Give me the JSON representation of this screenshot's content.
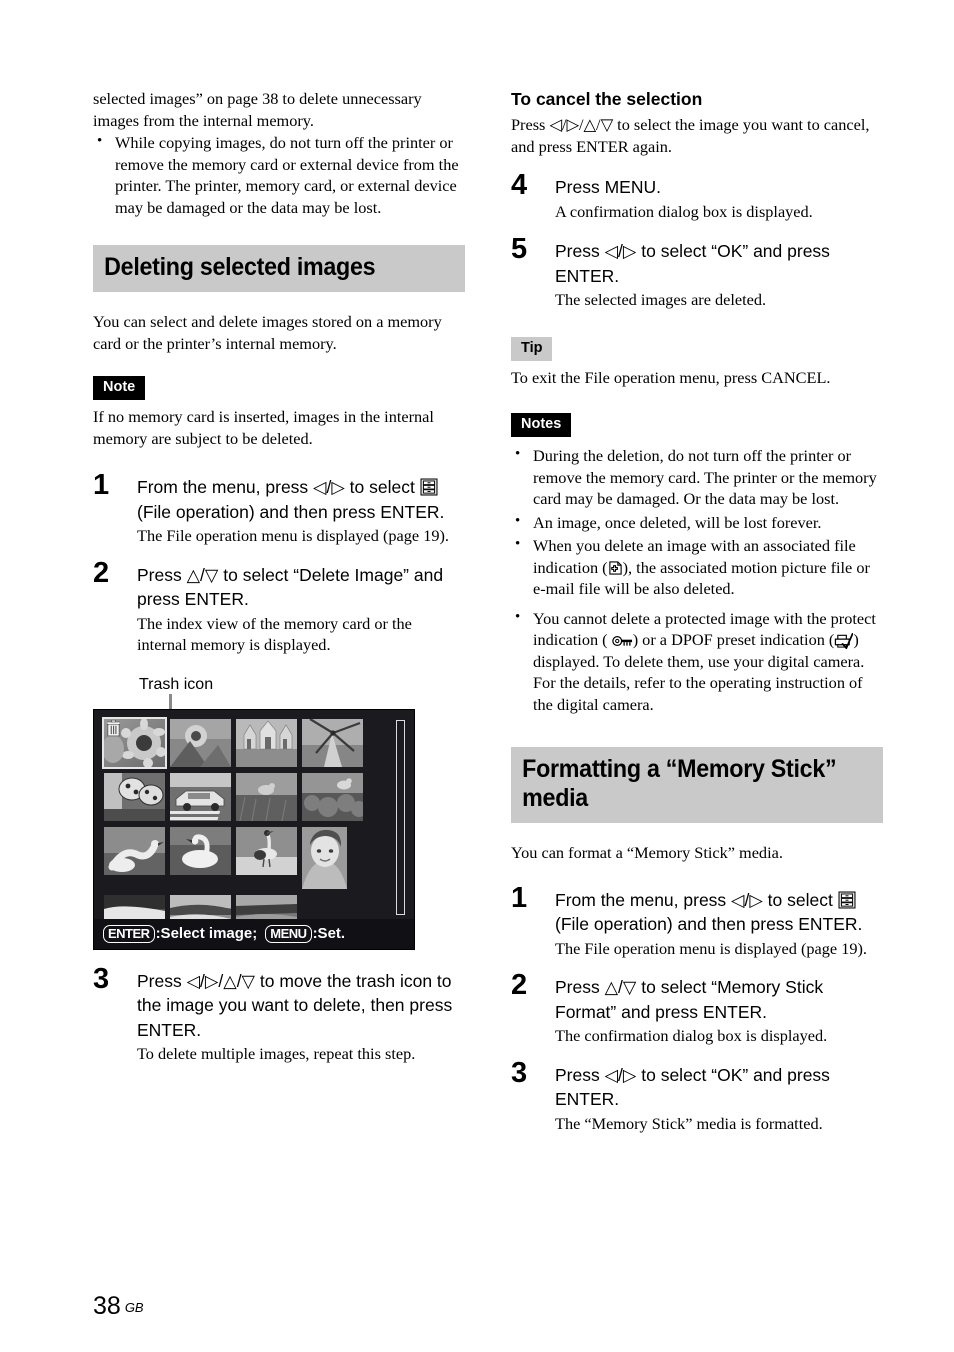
{
  "page": {
    "number": "38",
    "region": "GB"
  },
  "left_column": {
    "continued_paragraph": "selected images” on page 38 to delete unnecessary images from the internal memory.",
    "bullets": [
      "While copying images, do not turn off the printer or remove the memory card or external device from the printer. The printer, memory card, or external device may be damaged or the data may be lost."
    ],
    "section_heading": "Deleting selected images",
    "intro": "You can select and delete images stored on a memory card or the printer’s internal memory.",
    "note_label": "Note",
    "note_text": "If no memory card is inserted, images in the internal memory are subject to be deleted.",
    "steps": [
      {
        "num": "1",
        "main_before": "From the menu, press ◁/▷ to select",
        "main_after": "(File operation) and then press ENTER.",
        "sub": "The File operation menu is displayed (page 19)."
      },
      {
        "num": "2",
        "main": "Press △/▽ to select “Delete Image” and press ENTER.",
        "sub": "The index view of the memory card or the internal memory is displayed."
      },
      {
        "num": "3",
        "main": "Press ◁/▷/△/▽ to move the trash icon to the image you want to delete, then press ENTER.",
        "sub": "To delete multiple images, repeat this step."
      }
    ],
    "illustration": {
      "callout_label": "Trash icon",
      "status_bar": {
        "key1": "ENTER",
        "text1": ":Select image;",
        "key2": "MENU",
        "text2": ":Set."
      },
      "thumbnails": [
        [
          "sunflower",
          "sunflower-bud",
          "cathedral",
          "windmill"
        ],
        [
          "ladybugs",
          "taxi-crosswalk",
          "bird-in-grass",
          "bird-on-shrub"
        ],
        [
          "geese",
          "swan",
          "crane",
          "child-portrait"
        ],
        [
          "shoreline",
          "field-rows",
          "country-road",
          "empty"
        ]
      ],
      "selected_index": 0
    }
  },
  "right_column": {
    "cancel_subheading": "To cancel the selection",
    "cancel_text": "Press ◁/▷/△/▽ to select the image you want to cancel, and press ENTER again.",
    "steps": [
      {
        "num": "4",
        "main": "Press MENU.",
        "sub": "A confirmation dialog box is displayed."
      },
      {
        "num": "5",
        "main": "Press ◁/▷ to select “OK” and press ENTER.",
        "sub": "The selected images are deleted."
      }
    ],
    "tip_label": "Tip",
    "tip_text": "To exit the File operation menu, press CANCEL.",
    "notes_label": "Notes",
    "notes": [
      {
        "text": "During the deletion, do not turn off the printer or remove the memory card. The printer or the memory card may be damaged. Or the data may be lost."
      },
      {
        "text": "An image, once deleted, will be lost forever."
      },
      {
        "part1": "When you delete an image with an associated file indication (",
        "icon": "associated-file-icon",
        "part2": "), the associated motion picture file or e-mail file will be also deleted."
      },
      {
        "part1": "You cannot delete a protected image with the protect indication (",
        "icon1": "protect-key-icon",
        "part2": ") or a DPOF preset indication (",
        "icon2": "dpof-print-icon",
        "part3": ") displayed. To delete them, use your digital camera. For the details, refer to the operating instruction of the digital camera."
      }
    ],
    "section_heading": "Formatting a “Memory Stick” media",
    "intro": "You can format a “Memory Stick” media.",
    "format_steps": [
      {
        "num": "1",
        "main_before": "From the menu, press ◁/▷ to select",
        "main_after": "(File operation) and then press ENTER.",
        "sub": "The File operation menu is displayed (page 19)."
      },
      {
        "num": "2",
        "main": "Press △/▽ to select “Memory Stick Format” and press ENTER.",
        "sub": "The confirmation dialog box is displayed."
      },
      {
        "num": "3",
        "main": "Press ◁/▷ to select “OK” and press ENTER.",
        "sub": "The “Memory Stick” media is formatted."
      }
    ]
  },
  "colors": {
    "heading_bar": "#c9c9c9",
    "note_label_bg": "#000000",
    "tip_label_bg": "#c9c9c9",
    "lcd_bg": "#1b1b1f"
  }
}
